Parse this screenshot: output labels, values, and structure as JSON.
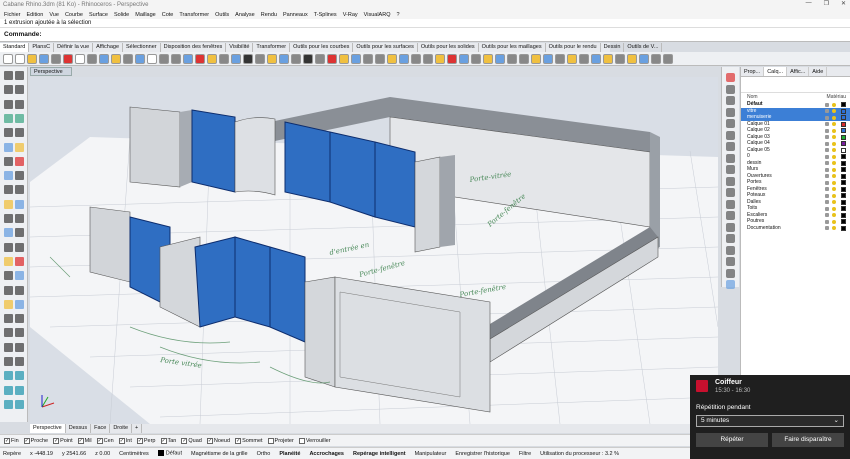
{
  "app": {
    "title": "Cabane Rhino.3dm (81 Ko) - Rhinoceros - Perspective",
    "window_controls": [
      "—",
      "❐",
      "✕"
    ]
  },
  "menu": [
    "Fichier",
    "Edition",
    "Vue",
    "Courbe",
    "Surface",
    "Solide",
    "Maillage",
    "Cote",
    "Transformer",
    "Outils",
    "Analyse",
    "Rendu",
    "Panneaux",
    "T-Splines",
    "V-Ray",
    "VisualARQ",
    "?"
  ],
  "command": {
    "history": "1 extrusion ajoutée à la sélection",
    "prompt": "Commande:"
  },
  "toolbar_tabs": [
    "Standard",
    "PlansC",
    "Définir la vue",
    "Affichage",
    "Sélectionner",
    "Disposition des fenêtres",
    "Visibilité",
    "Transformer",
    "Outils pour les courbes",
    "Outils pour les surfaces",
    "Outils pour les solides",
    "Outils pour les maillages",
    "Outils pour le rendu",
    "Dessin",
    "Outils de V..."
  ],
  "viewport": {
    "active_label": "Perspective",
    "tabs": [
      "Perspective",
      "Dessus",
      "Face",
      "Droite",
      "+"
    ],
    "annotations": [
      "Porte-vitrée",
      "Porte-fenêtre",
      "Porte-fenêtre",
      "d'entrée en",
      "Porte-fenêtre",
      "Porte vitrée"
    ]
  },
  "layers_panel": {
    "tabs": [
      "Prop...",
      "Calq...",
      "Affic...",
      "Aide"
    ],
    "columns": {
      "name": "Nom",
      "material": "Matériau"
    },
    "layers": [
      {
        "name": "Défaut",
        "bold": true,
        "selected": false,
        "color": "#000000"
      },
      {
        "name": "vitre",
        "bold": false,
        "selected": true,
        "color": "#2b6fd6"
      },
      {
        "name": "menuiserie",
        "bold": false,
        "selected": true,
        "color": "#2b6fd6"
      },
      {
        "name": "Calque 01",
        "bold": false,
        "selected": false,
        "color": "#d62b2b"
      },
      {
        "name": "Calque 02",
        "bold": false,
        "selected": false,
        "color": "#2b6fd6"
      },
      {
        "name": "Calque 03",
        "bold": false,
        "selected": false,
        "color": "#1faa33"
      },
      {
        "name": "Calque 04",
        "bold": false,
        "selected": false,
        "color": "#7a1fa0"
      },
      {
        "name": "Calque 05",
        "bold": false,
        "selected": false,
        "color": "#ffffff"
      },
      {
        "name": "0",
        "bold": false,
        "selected": false,
        "color": "#000000"
      },
      {
        "name": "dessin",
        "bold": false,
        "selected": false,
        "color": "#000000"
      },
      {
        "name": "Murs",
        "bold": false,
        "selected": false,
        "color": "#000000"
      },
      {
        "name": "Ouvertures",
        "bold": false,
        "selected": false,
        "color": "#000000"
      },
      {
        "name": "Portes",
        "bold": false,
        "selected": false,
        "color": "#000000"
      },
      {
        "name": "Fenêtres",
        "bold": false,
        "selected": false,
        "color": "#000000"
      },
      {
        "name": "Poteaux",
        "bold": false,
        "selected": false,
        "color": "#000000"
      },
      {
        "name": "Dalles",
        "bold": false,
        "selected": false,
        "color": "#000000"
      },
      {
        "name": "Toits",
        "bold": false,
        "selected": false,
        "color": "#000000"
      },
      {
        "name": "Escaliers",
        "bold": false,
        "selected": false,
        "color": "#000000"
      },
      {
        "name": "Poutres",
        "bold": false,
        "selected": false,
        "color": "#000000"
      },
      {
        "name": "Documentation",
        "bold": false,
        "selected": false,
        "color": "#000000"
      }
    ]
  },
  "osnaps": [
    {
      "label": "Fin",
      "checked": true
    },
    {
      "label": "Proche",
      "checked": true
    },
    {
      "label": "Point",
      "checked": true
    },
    {
      "label": "Mil",
      "checked": true
    },
    {
      "label": "Cen",
      "checked": true
    },
    {
      "label": "Int",
      "checked": true
    },
    {
      "label": "Perp",
      "checked": true
    },
    {
      "label": "Tan",
      "checked": true
    },
    {
      "label": "Quad",
      "checked": true
    },
    {
      "label": "Noeud",
      "checked": true
    },
    {
      "label": "Sommet",
      "checked": true
    },
    {
      "label": "Projeter",
      "checked": false
    },
    {
      "label": "Verrouiller",
      "checked": false
    }
  ],
  "status": {
    "plane": "Repère",
    "x": "x -448.19",
    "y": "y 2541.66",
    "z": "z 0.00",
    "units": "Centimètres",
    "layer": "Défaut",
    "toggles": [
      "Magnétisme de la grille",
      "Ortho",
      "Planéité",
      "Accrochages",
      "Repérage intelligent",
      "Manipulateur",
      "Enregistrer l'historique",
      "Filtre",
      "Utilisation du processeur : 3.2 %"
    ],
    "bold_toggles": [
      "Planéité",
      "Accrochages",
      "Repérage intelligent"
    ]
  },
  "notification": {
    "app": "Coiffeur",
    "time": "15:30 - 16:30",
    "repeat_label": "Répétition pendant",
    "repeat_value": "5 minutes",
    "repeat_button": "Répéter",
    "dismiss_button": "Faire disparaître"
  }
}
